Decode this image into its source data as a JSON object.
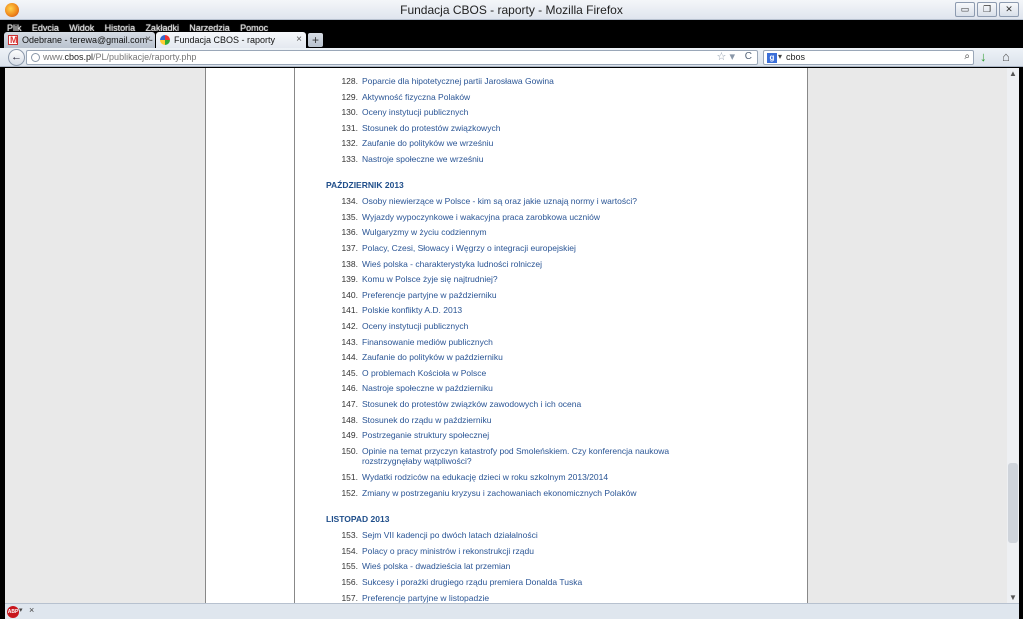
{
  "window": {
    "title": "Fundacja CBOS - raporty - Mozilla Firefox"
  },
  "menu": [
    "Plik",
    "Edycja",
    "Widok",
    "Historia",
    "Zakładki",
    "Narzędzia",
    "Pomoc"
  ],
  "tabs": {
    "inactive_label": "Odebrane - terewa@gmail.com - Gm...",
    "active_label": "Fundacja CBOS - raporty",
    "new_tab": "+"
  },
  "navbar": {
    "url_prefix": "www.",
    "url_domain": "cbos.pl",
    "url_path": "/PL/publikacje/raporty.php",
    "search_query": "cbos"
  },
  "sections": [
    {
      "title": "",
      "items": [
        {
          "num": "128.",
          "text": "Poparcie dla hipotetycznej partii Jarosława Gowina"
        },
        {
          "num": "129.",
          "text": "Aktywność fizyczna Polaków"
        },
        {
          "num": "130.",
          "text": "Oceny instytucji publicznych"
        },
        {
          "num": "131.",
          "text": "Stosunek do protestów związkowych"
        },
        {
          "num": "132.",
          "text": "Zaufanie do polityków we wrześniu"
        },
        {
          "num": "133.",
          "text": "Nastroje społeczne we wrześniu"
        }
      ]
    },
    {
      "title": "PAŹDZIERNIK 2013",
      "items": [
        {
          "num": "134.",
          "text": "Osoby niewierzące w Polsce - kim są oraz jakie uznają normy i wartości?"
        },
        {
          "num": "135.",
          "text": "Wyjazdy wypoczynkowe i wakacyjna praca zarobkowa uczniów"
        },
        {
          "num": "136.",
          "text": "Wulgaryzmy w życiu codziennym"
        },
        {
          "num": "137.",
          "text": "Polacy, Czesi, Słowacy i Węgrzy o integracji europejskiej"
        },
        {
          "num": "138.",
          "text": "Wieś polska - charakterystyka ludności rolniczej"
        },
        {
          "num": "139.",
          "text": "Komu w Polsce żyje się najtrudniej?"
        },
        {
          "num": "140.",
          "text": "Preferencje partyjne w październiku"
        },
        {
          "num": "141.",
          "text": "Polskie konflikty A.D. 2013"
        },
        {
          "num": "142.",
          "text": "Oceny instytucji publicznych"
        },
        {
          "num": "143.",
          "text": "Finansowanie mediów publicznych"
        },
        {
          "num": "144.",
          "text": "Zaufanie do polityków w październiku"
        },
        {
          "num": "145.",
          "text": "O problemach Kościoła w Polsce"
        },
        {
          "num": "146.",
          "text": "Nastroje społeczne w październiku"
        },
        {
          "num": "147.",
          "text": "Stosunek do protestów związków zawodowych i ich ocena"
        },
        {
          "num": "148.",
          "text": "Stosunek do rządu w październiku"
        },
        {
          "num": "149.",
          "text": "Postrzeganie struktury społecznej"
        },
        {
          "num": "150.",
          "text": "Opinie na temat przyczyn katastrofy pod Smoleńskiem. Czy konferencja naukowa rozstrzygnęłaby wątpliwości?"
        },
        {
          "num": "151.",
          "text": "Wydatki rodziców na edukację dzieci w roku szkolnym 2013/2014"
        },
        {
          "num": "152.",
          "text": "Zmiany w postrzeganiu kryzysu i zachowaniach ekonomicznych Polaków"
        }
      ]
    },
    {
      "title": "LISTOPAD 2013",
      "items": [
        {
          "num": "153.",
          "text": "Sejm VII kadencji po dwóch latach działalności"
        },
        {
          "num": "154.",
          "text": "Polacy o pracy ministrów i rekonstrukcji rządu"
        },
        {
          "num": "155.",
          "text": "Wieś polska - dwadzieścia lat przemian"
        },
        {
          "num": "156.",
          "text": "Sukcesy i porażki drugiego rządu premiera Donalda Tuska"
        },
        {
          "num": "157.",
          "text": "Preferencje partyjne w listopadzie"
        }
      ]
    }
  ],
  "statusbar": {
    "addon": "ABP",
    "close": "×"
  },
  "colors": {
    "link": "#2a5595",
    "heading": "#1f4e8a",
    "page_bg": "#e9e9e9"
  }
}
